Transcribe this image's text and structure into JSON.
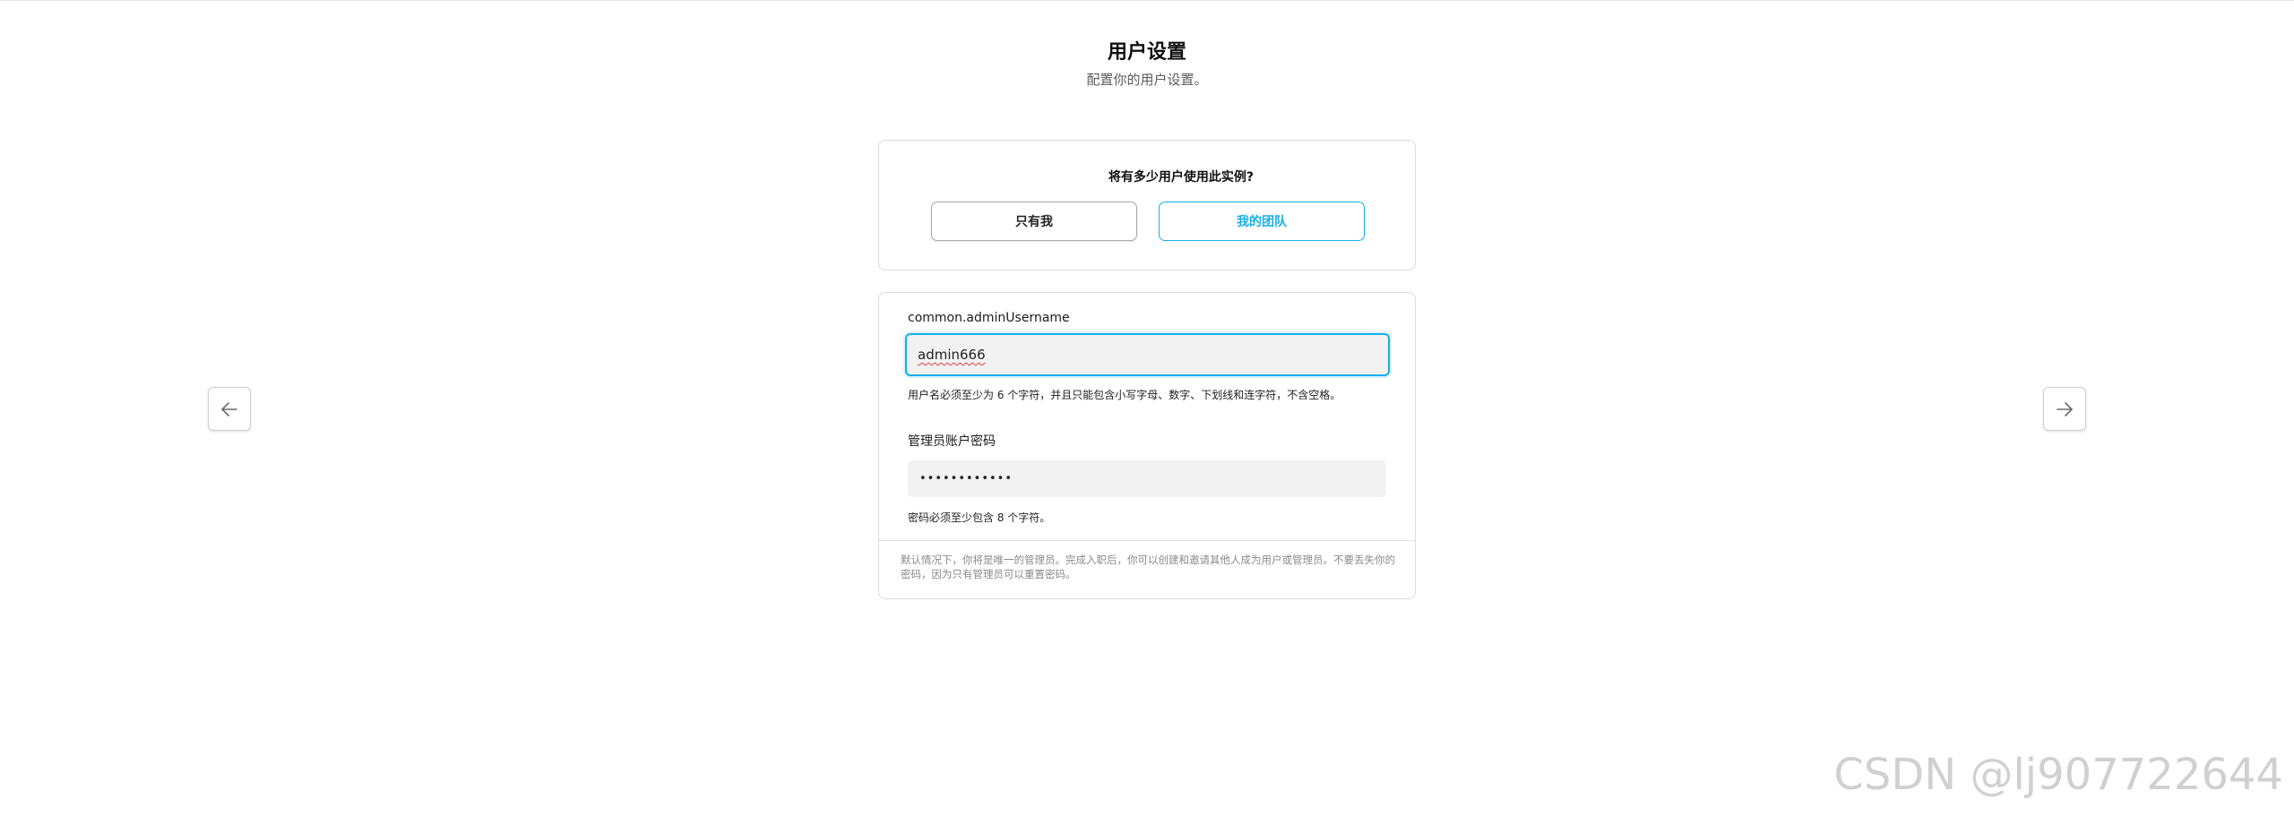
{
  "header": {
    "title": "用户设置",
    "subtitle": "配置你的用户设置。"
  },
  "users_card": {
    "question": "将有多少用户使用此实例?",
    "option_only_me": "只有我",
    "option_my_team": "我的团队",
    "selected": "我的团队"
  },
  "admin_card": {
    "username_label": "common.adminUsername",
    "username_value": "admin666",
    "username_hint": "用户名必须至少为 6 个字符，并且只能包含小写字母、数字、下划线和连字符，不含空格。",
    "password_label": "管理员账户密码",
    "password_value": "••••••••••••",
    "password_hint": "密码必须至少包含 8 个字符。",
    "footnote": "默认情况下，你将是唯一的管理员。完成入职后，你可以创建和邀请其他人成为用户或管理员。不要丢失你的密码，因为只有管理员可以重置密码。"
  },
  "navigation": {
    "prev_icon": "arrow-left-icon",
    "next_icon": "arrow-right-icon"
  },
  "watermark": "CSDN @lj907722644",
  "colors": {
    "accent": "#18aee6",
    "border": "#dcdcdc",
    "input_bg": "#f2f2f2"
  }
}
